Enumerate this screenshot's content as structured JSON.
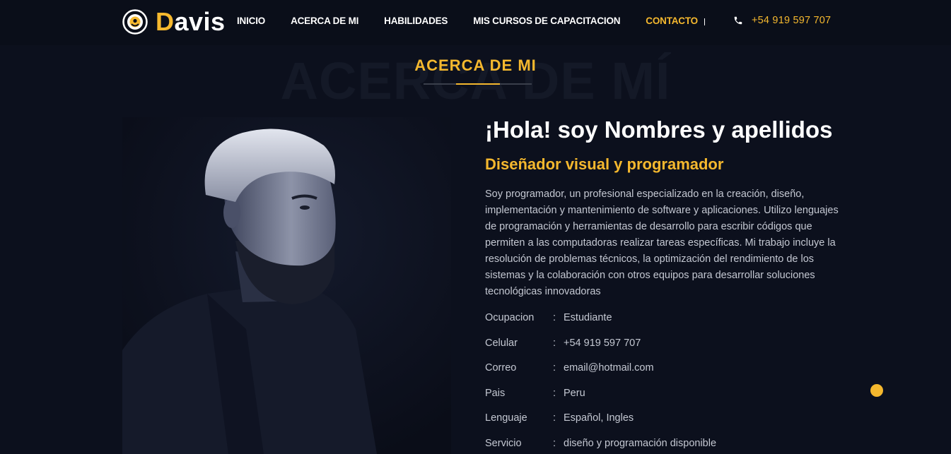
{
  "brand": {
    "initial": "D",
    "rest": "avis",
    "accent_color": "#f5b82e",
    "icon": "sun-shield-logo-icon"
  },
  "nav": {
    "items": [
      {
        "label": "INICIO",
        "active": false
      },
      {
        "label": "ACERCA DE MI",
        "active": false
      },
      {
        "label": "HABILIDADES",
        "active": false
      },
      {
        "label": "MIS CURSOS DE CAPACITACION",
        "active": false
      },
      {
        "label": "CONTACTO",
        "active": true
      }
    ],
    "phone_icon": "phone-icon",
    "phone": "+54 919 597 707"
  },
  "section": {
    "background_title": "ACERCA DE MÍ",
    "title": "ACERCA DE MI"
  },
  "photo": {
    "description_icon": "profile-photo"
  },
  "about": {
    "greeting": "¡Hola! soy Nombres y apellidos",
    "role": "Diseñador visual y programador",
    "bio": "Soy programador, un profesional especializado en la creación, diseño, implementación y mantenimiento de software y aplicaciones. Utilizo lenguajes de programación y herramientas de desarrollo para escribir códigos que permiten a las computadoras realizar tareas específicas. Mi trabajo incluye la resolución de problemas técnicos, la optimización del rendimiento de los sistemas y la colaboración con otros equipos para desarrollar soluciones tecnológicas innovadoras",
    "info": [
      {
        "label": "Ocupacion",
        "sep": ":",
        "value": "Estudiante"
      },
      {
        "label": "Celular",
        "sep": ":",
        "value": "+54 919 597 707"
      },
      {
        "label": "Correo",
        "sep": ":",
        "value": "email@hotmail.com"
      },
      {
        "label": "Pais",
        "sep": ":",
        "value": "Peru"
      },
      {
        "label": "Lenguaje",
        "sep": ":",
        "value": "Español, Ingles"
      },
      {
        "label": "Servicio",
        "sep": ":",
        "value": "diseño y programación disponible"
      }
    ]
  },
  "colors": {
    "background": "#0c101d",
    "header": "#0a0e19",
    "accent": "#f5b82e",
    "body_text": "#c4c8d2"
  }
}
